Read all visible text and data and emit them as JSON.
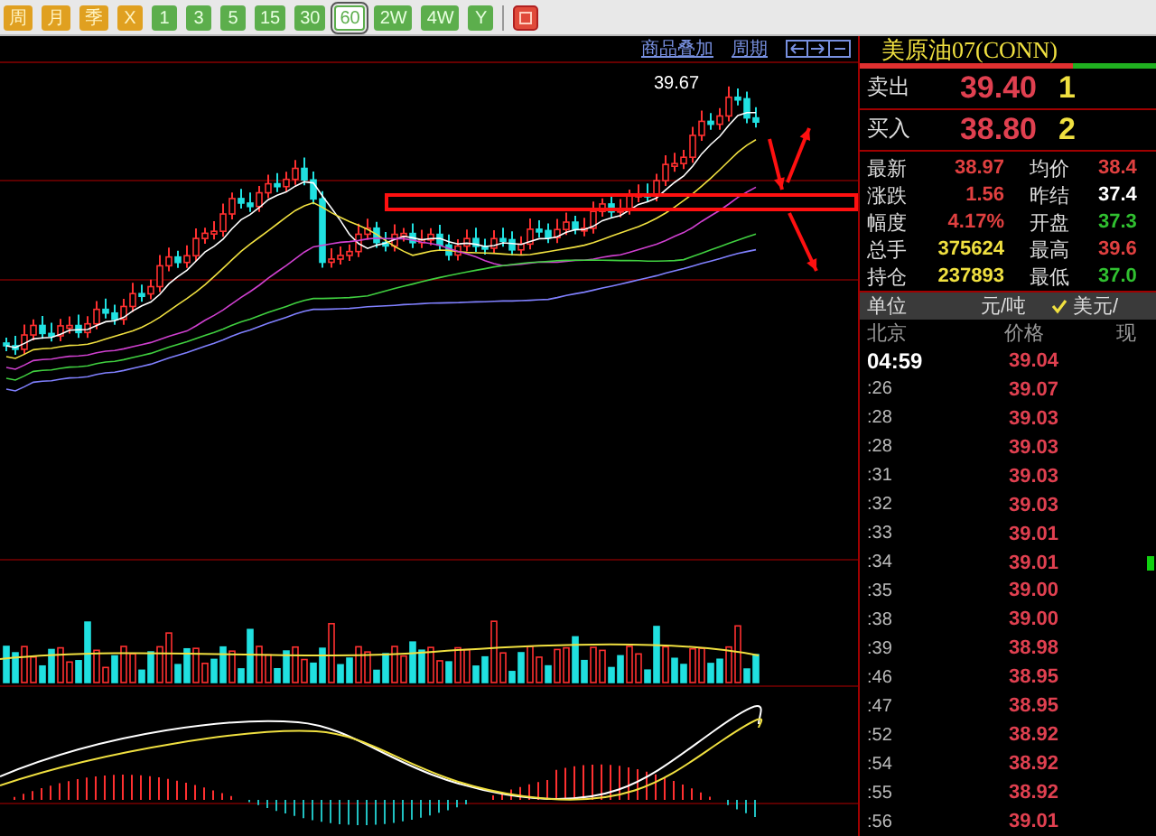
{
  "toolbar": {
    "buttons": [
      {
        "label": "周",
        "kind": "calendar",
        "selected": false
      },
      {
        "label": "月",
        "kind": "calendar",
        "selected": false
      },
      {
        "label": "季",
        "kind": "calendar",
        "selected": false
      },
      {
        "label": "X",
        "kind": "calendar",
        "selected": false
      },
      {
        "label": "1",
        "kind": "minute",
        "selected": false
      },
      {
        "label": "3",
        "kind": "minute",
        "selected": false
      },
      {
        "label": "5",
        "kind": "minute",
        "selected": false
      },
      {
        "label": "15",
        "kind": "minute",
        "selected": false
      },
      {
        "label": "30",
        "kind": "minute",
        "selected": false
      },
      {
        "label": "60",
        "kind": "minute",
        "selected": true
      },
      {
        "label": "2W",
        "kind": "minute",
        "selected": false
      },
      {
        "label": "4W",
        "kind": "minute",
        "selected": false
      },
      {
        "label": "Y",
        "kind": "minute",
        "selected": false
      }
    ]
  },
  "chart": {
    "links": [
      "商品叠加",
      "周期"
    ],
    "high_label": "39.67"
  },
  "quote": {
    "title": "美原油07(CONN)",
    "ratio": {
      "level": 0.72
    },
    "orders": [
      {
        "label": "卖出",
        "price": "39.40",
        "qty": "1"
      },
      {
        "label": "买入",
        "price": "38.80",
        "qty": "2"
      }
    ],
    "stats": [
      [
        {
          "label": "最新",
          "value": "38.97",
          "color": "#e04040"
        },
        {
          "label": "均价",
          "value": "38.4",
          "color": "#e04040"
        }
      ],
      [
        {
          "label": "涨跌",
          "value": "1.56",
          "color": "#e04040"
        },
        {
          "label": "昨结",
          "value": "37.4",
          "color": "#ffffff"
        }
      ],
      [
        {
          "label": "幅度",
          "value": "4.17%",
          "color": "#e04040"
        },
        {
          "label": "开盘",
          "value": "37.3",
          "color": "#30c030"
        }
      ],
      [
        {
          "label": "总手",
          "value": "375624",
          "color": "#f0e040"
        },
        {
          "label": "最高",
          "value": "39.6",
          "color": "#e04040"
        }
      ],
      [
        {
          "label": "持仓",
          "value": "237893",
          "color": "#f0e040"
        },
        {
          "label": "最低",
          "value": "37.0",
          "color": "#30c030"
        }
      ]
    ],
    "unit": {
      "label": "单位",
      "value": "元/吨",
      "option": "美元/",
      "checked": true
    },
    "ticks": {
      "columns": [
        "北京",
        "价格",
        "现"
      ],
      "rows": [
        {
          "time": "04:59",
          "price": "39.04",
          "kind": "hour",
          "marked": false
        },
        {
          "time": ":26",
          "price": "39.07",
          "kind": "minute",
          "marked": false
        },
        {
          "time": ":28",
          "price": "39.03",
          "kind": "minute",
          "marked": false
        },
        {
          "time": ":28",
          "price": "39.03",
          "kind": "minute",
          "marked": false
        },
        {
          "time": ":31",
          "price": "39.03",
          "kind": "minute",
          "marked": false
        },
        {
          "time": ":32",
          "price": "39.03",
          "kind": "minute",
          "marked": false
        },
        {
          "time": ":33",
          "price": "39.01",
          "kind": "minute",
          "marked": false
        },
        {
          "time": ":34",
          "price": "39.01",
          "kind": "minute",
          "marked": true
        },
        {
          "time": ":35",
          "price": "39.00",
          "kind": "minute",
          "marked": false
        },
        {
          "time": ":38",
          "price": "39.00",
          "kind": "minute",
          "marked": false
        },
        {
          "time": ":39",
          "price": "38.98",
          "kind": "minute",
          "marked": false
        },
        {
          "time": ":46",
          "price": "38.95",
          "kind": "minute",
          "marked": false
        },
        {
          "time": ":47",
          "price": "38.95",
          "kind": "minute",
          "marked": false
        },
        {
          "time": ":52",
          "price": "38.92",
          "kind": "minute",
          "marked": false
        },
        {
          "time": ":54",
          "price": "38.92",
          "kind": "minute",
          "marked": false
        },
        {
          "time": ":55",
          "price": "38.92",
          "kind": "minute",
          "marked": false
        },
        {
          "time": ":56",
          "price": "39.01",
          "kind": "minute",
          "marked": false
        }
      ]
    }
  }
}
